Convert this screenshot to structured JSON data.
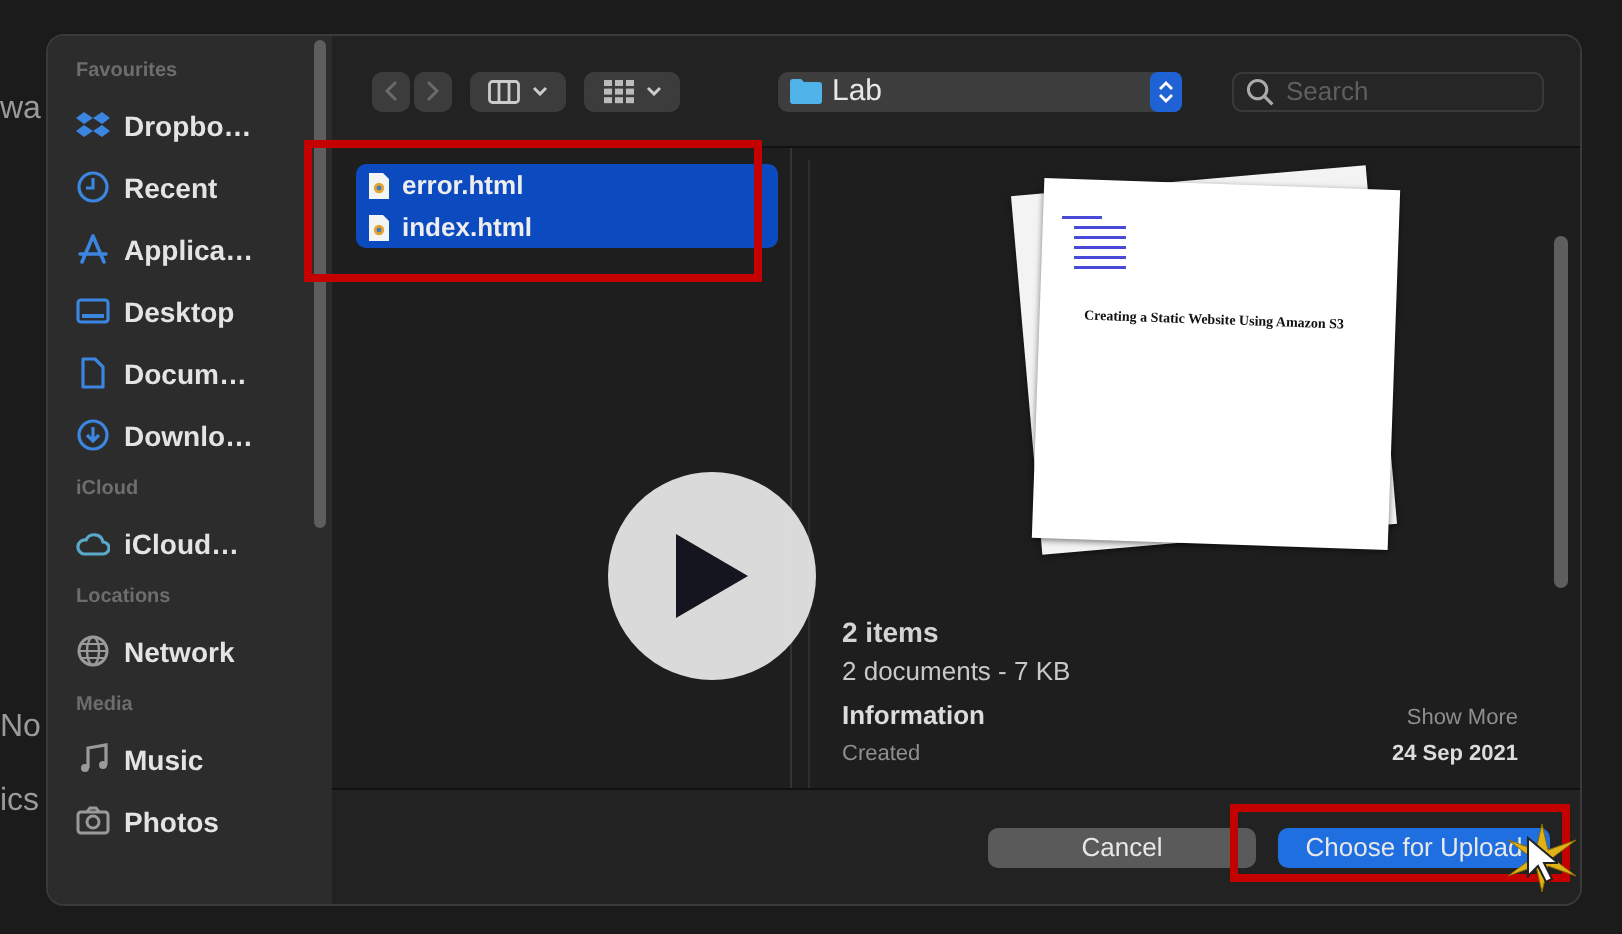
{
  "background": {
    "fragments": [
      "wa",
      "No",
      "ics"
    ]
  },
  "sidebar": {
    "sections": [
      {
        "title": "Favourites",
        "items": [
          {
            "label": "Dropbo…"
          },
          {
            "label": "Recent"
          },
          {
            "label": "Applica…"
          },
          {
            "label": "Desktop"
          },
          {
            "label": "Docum…"
          },
          {
            "label": "Downlo…"
          }
        ]
      },
      {
        "title": "iCloud",
        "items": [
          {
            "label": "iCloud…"
          }
        ]
      },
      {
        "title": "Locations",
        "items": [
          {
            "label": "Network"
          }
        ]
      },
      {
        "title": "Media",
        "items": [
          {
            "label": "Music"
          },
          {
            "label": "Photos"
          }
        ]
      }
    ]
  },
  "toolbar": {
    "location": "Lab",
    "search": {
      "placeholder": "Search"
    }
  },
  "files": [
    {
      "name": "error.html",
      "selected": true
    },
    {
      "name": "index.html",
      "selected": true
    }
  ],
  "preview": {
    "document_title": "Creating a Static Website Using Amazon S3",
    "summary": "2 items",
    "detail": "2 documents - 7 KB",
    "info_heading": "Information",
    "show_more": "Show More",
    "rows": [
      {
        "label": "Created",
        "value": "24 Sep 2021"
      }
    ]
  },
  "buttons": [
    {
      "label": "Cancel",
      "kind": "secondary"
    },
    {
      "label": "Choose for Upload",
      "kind": "primary"
    }
  ]
}
